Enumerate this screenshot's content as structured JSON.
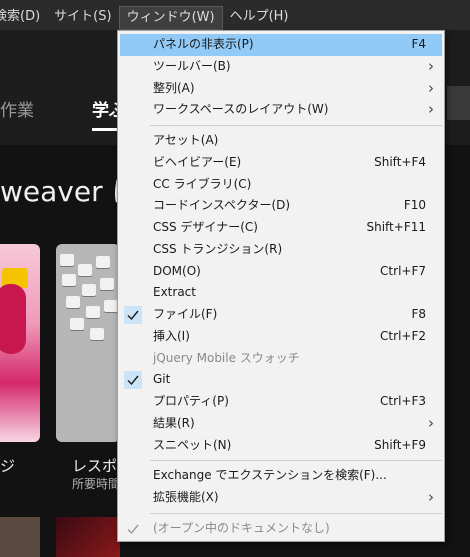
{
  "menubar": {
    "items": [
      "検索(D)",
      "サイト(S)",
      "ウィンドウ(W)",
      "ヘルプ(H)"
    ]
  },
  "background": {
    "tabs": [
      "作業",
      "学ぶ"
    ],
    "title": "weaver に",
    "card_label": "レスポン",
    "card_sub": "所要時間",
    "left_label": "ジ"
  },
  "menu": {
    "groups": [
      [
        {
          "label": "パネルの非表示(P)",
          "shortcut": "F4",
          "highlighted": true
        },
        {
          "label": "ツールバー(B)",
          "submenu": true
        },
        {
          "label": "整列(A)",
          "submenu": true
        },
        {
          "label": "ワークスペースのレイアウト(W)",
          "submenu": true
        }
      ],
      [
        {
          "label": "アセット(A)"
        },
        {
          "label": "ビヘイビアー(E)",
          "shortcut": "Shift+F4"
        },
        {
          "label": "CC ライブラリ(C)"
        },
        {
          "label": "コードインスペクター(D)",
          "shortcut": "F10"
        },
        {
          "label": "CSS デザイナー(C)",
          "shortcut": "Shift+F11"
        },
        {
          "label": "CSS トランジション(R)"
        },
        {
          "label": "DOM(O)",
          "shortcut": "Ctrl+F7"
        },
        {
          "label": "Extract"
        },
        {
          "label": "ファイル(F)",
          "shortcut": "F8",
          "checked": true
        },
        {
          "label": "挿入(I)",
          "shortcut": "Ctrl+F2"
        },
        {
          "label": "jQuery Mobile スウォッチ",
          "disabled": true
        },
        {
          "label": "Git",
          "checked": true
        },
        {
          "label": "プロパティ(P)",
          "shortcut": "Ctrl+F3"
        },
        {
          "label": "結果(R)",
          "submenu": true
        },
        {
          "label": "スニペット(N)",
          "shortcut": "Shift+F9"
        }
      ],
      [
        {
          "label": "Exchange でエクステンションを検索(F)..."
        },
        {
          "label": "拡張機能(X)",
          "submenu": true
        }
      ],
      [
        {
          "label": "(オープン中のドキュメントなし)",
          "checked": true,
          "disabled": true
        }
      ]
    ]
  },
  "colors": {
    "highlight": "#91c9f7",
    "check_bg": "#cce4f7",
    "menu_bg": "#f2f2f2",
    "app_bg": "#1d1d1d"
  }
}
